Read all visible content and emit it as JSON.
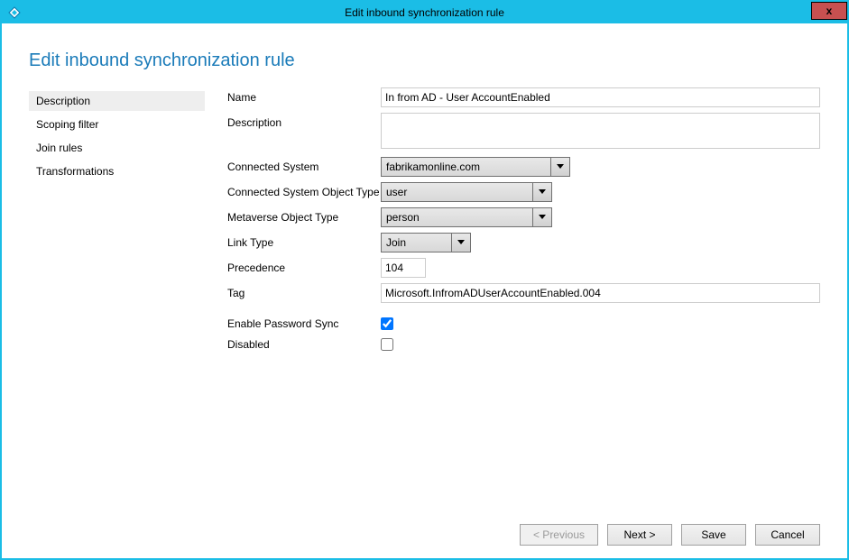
{
  "window": {
    "title": "Edit inbound synchronization rule",
    "close_label": "x"
  },
  "page": {
    "heading": "Edit inbound synchronization rule"
  },
  "sidebar": {
    "items": [
      {
        "label": "Description",
        "selected": true
      },
      {
        "label": "Scoping filter",
        "selected": false
      },
      {
        "label": "Join rules",
        "selected": false
      },
      {
        "label": "Transformations",
        "selected": false
      }
    ]
  },
  "form": {
    "name": {
      "label": "Name",
      "value": "In from AD - User AccountEnabled"
    },
    "description": {
      "label": "Description",
      "value": ""
    },
    "connectedSystem": {
      "label": "Connected System",
      "value": "fabrikamonline.com"
    },
    "csObjectType": {
      "label": "Connected System Object Type",
      "value": "user"
    },
    "mvObjectType": {
      "label": "Metaverse Object Type",
      "value": "person"
    },
    "linkType": {
      "label": "Link Type",
      "value": "Join"
    },
    "precedence": {
      "label": "Precedence",
      "value": "104"
    },
    "tag": {
      "label": "Tag",
      "value": "Microsoft.InfromADUserAccountEnabled.004"
    },
    "enablePwdSync": {
      "label": "Enable Password Sync",
      "checked": true
    },
    "disabled": {
      "label": "Disabled",
      "checked": false
    }
  },
  "footer": {
    "previous": "< Previous",
    "next": "Next >",
    "save": "Save",
    "cancel": "Cancel"
  }
}
